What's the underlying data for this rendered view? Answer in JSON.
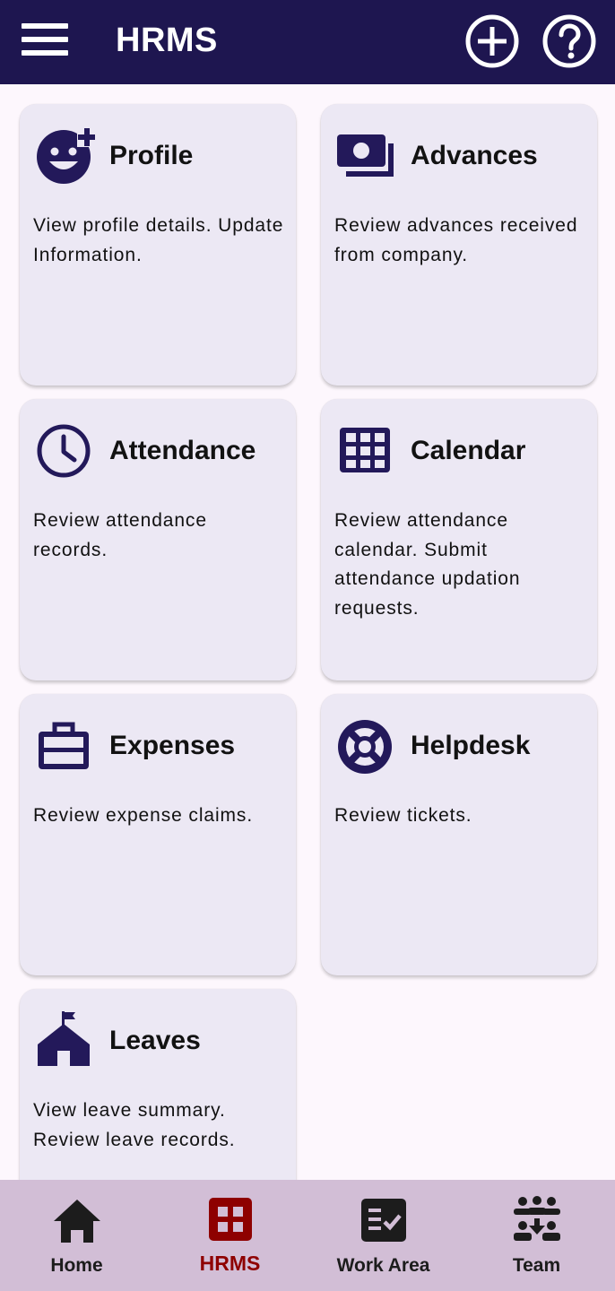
{
  "app": {
    "title": "HRMS",
    "colors": {
      "header": "#1e1650",
      "accent": "#8e0000",
      "icon": "#23195a",
      "card": "#ece8f4",
      "bottom_nav": "#d2bed6"
    }
  },
  "header": {
    "menu_icon": "hamburger-menu-icon",
    "add_icon": "add-circle-icon",
    "help_icon": "help-circle-icon"
  },
  "cards": [
    {
      "title": "Profile",
      "description": "View profile details. Update Information.",
      "icon": "add-reaction-icon"
    },
    {
      "title": "Advances",
      "description": "Review advances received from company.",
      "icon": "payments-icon"
    },
    {
      "title": "Attendance",
      "description": "Review attendance records.",
      "icon": "clock-icon"
    },
    {
      "title": "Calendar",
      "description": "Review attendance calendar. Submit attendance updation requests.",
      "icon": "grid-calendar-icon"
    },
    {
      "title": "Expenses",
      "description": "Review expense claims.",
      "icon": "briefcase-icon"
    },
    {
      "title": "Helpdesk",
      "description": "Review tickets.",
      "icon": "lifebuoy-icon"
    },
    {
      "title": "Leaves",
      "description": "View leave summary. Review leave records.",
      "icon": "school-icon"
    }
  ],
  "bottom_nav": {
    "active": "HRMS",
    "items": [
      {
        "label": "Home",
        "icon": "home-icon"
      },
      {
        "label": "HRMS",
        "icon": "apps-icon"
      },
      {
        "label": "Work Area",
        "icon": "checklist-icon"
      },
      {
        "label": "Team",
        "icon": "groups-icon"
      }
    ]
  }
}
